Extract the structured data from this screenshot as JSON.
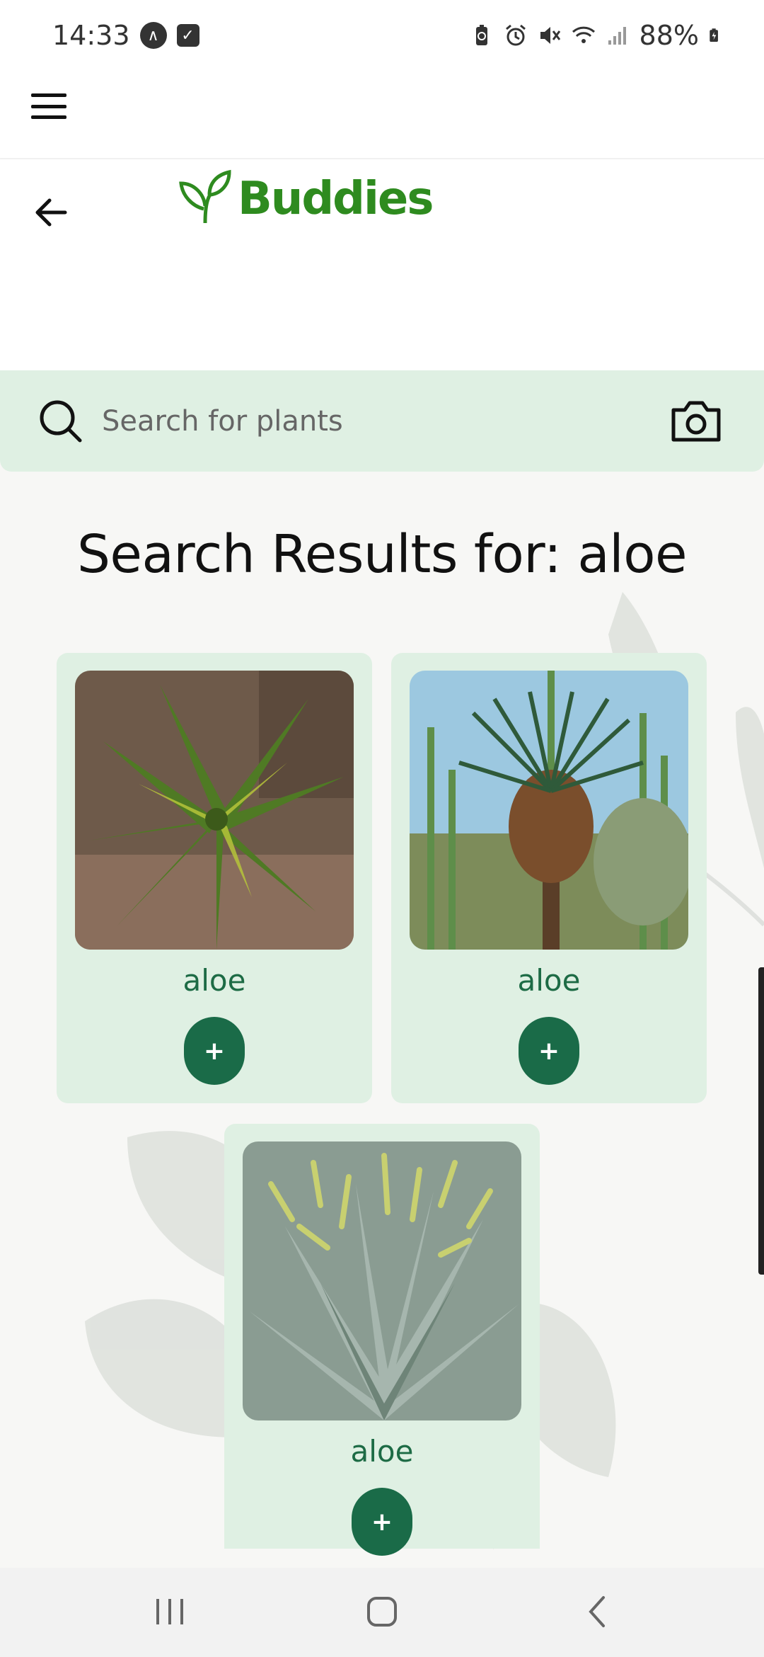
{
  "status_bar": {
    "time": "14:33",
    "battery": "88%",
    "icons": [
      "assistant-icon",
      "checkbox-icon",
      "battery-saver-icon",
      "alarm-icon",
      "mute-icon",
      "wifi-icon",
      "signal-icon",
      "battery-charging-icon"
    ]
  },
  "app": {
    "logo_text": "Buddies",
    "brand_color": "#2e8b1f",
    "accent_color": "#1a6b48",
    "card_color": "#dff0e3"
  },
  "search": {
    "placeholder": "Search for plants",
    "value": ""
  },
  "results": {
    "title": "Search Results for: aloe",
    "items": [
      {
        "name": "aloe",
        "add_label": "+"
      },
      {
        "name": "aloe",
        "add_label": "+"
      },
      {
        "name": "aloe",
        "add_label": "+"
      }
    ]
  },
  "nav": {
    "recents": "recent-apps-icon",
    "home": "home-icon",
    "back": "back-icon"
  }
}
